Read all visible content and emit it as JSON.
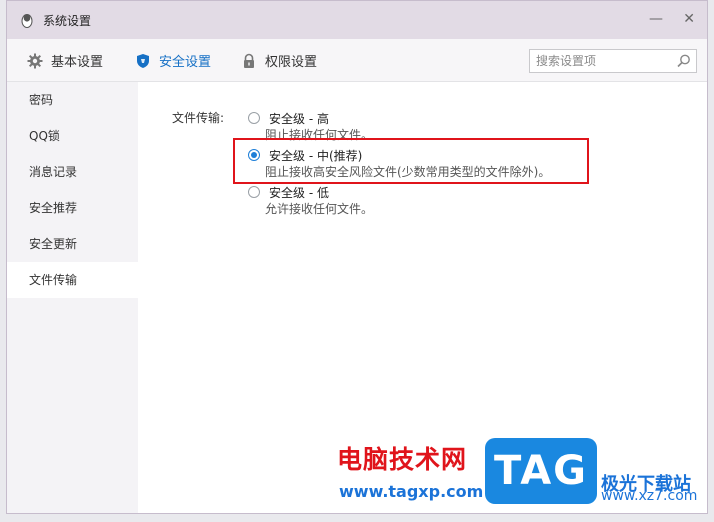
{
  "window": {
    "title": "系统设置",
    "minimize_label": "—",
    "close_label": "✕"
  },
  "tabs": [
    {
      "label": "基本设置",
      "icon": "gear-icon"
    },
    {
      "label": "安全设置",
      "icon": "shield-icon",
      "active": true
    },
    {
      "label": "权限设置",
      "icon": "lock-icon"
    }
  ],
  "search": {
    "placeholder": "搜索设置项",
    "value": ""
  },
  "sidebar": {
    "items": [
      {
        "label": "密码"
      },
      {
        "label": "QQ锁"
      },
      {
        "label": "消息记录"
      },
      {
        "label": "安全推荐"
      },
      {
        "label": "安全更新"
      },
      {
        "label": "文件传输",
        "active": true
      }
    ]
  },
  "file_transfer": {
    "label": "文件传输:",
    "options": [
      {
        "title": "安全级 - 高",
        "desc": "阻止接收任何文件。",
        "checked": false
      },
      {
        "title": "安全级 - 中(推荐)",
        "desc": "阻止接收高安全风险文件(少数常用类型的文件除外)。",
        "checked": true
      },
      {
        "title": "安全级 - 低",
        "desc": "允许接收任何文件。",
        "checked": false
      }
    ]
  },
  "watermark": {
    "cn": "电脑技术网",
    "url": "www.tagxp.com",
    "logo": "TAG",
    "side": "极光下载站",
    "side_url": "www.xz7.com"
  },
  "colors": {
    "accent": "#1670c5",
    "highlight_border": "#e0141b",
    "titlebar": "#e2dbe5"
  }
}
